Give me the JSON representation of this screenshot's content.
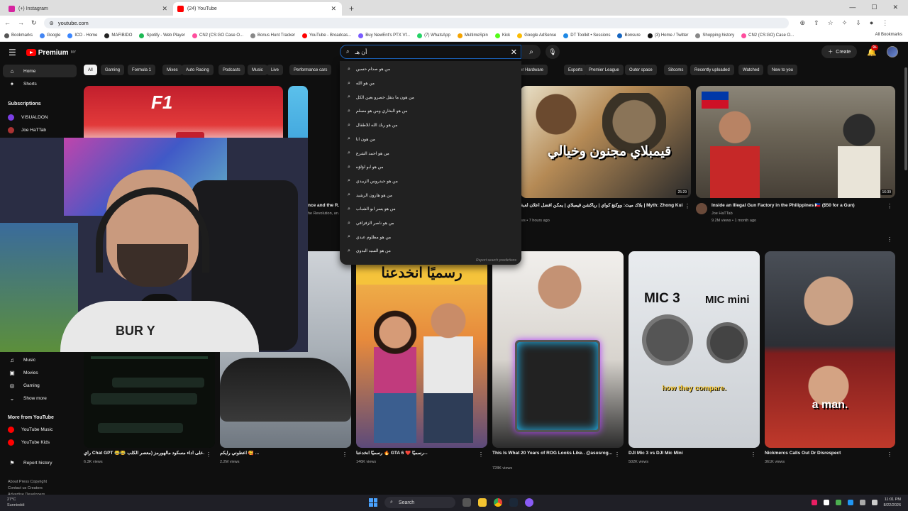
{
  "browser": {
    "tabs": [
      {
        "title": "(+) Instagram",
        "color": "#d6249f",
        "active": false
      },
      {
        "title": "(24) YouTube",
        "color": "#ff0000",
        "active": true
      }
    ],
    "new_tab": "+",
    "url": "youtube.com",
    "bookmarks": [
      {
        "label": "Bookmarks",
        "color": "#555"
      },
      {
        "label": "Google",
        "color": "#4285f4"
      },
      {
        "label": "ICO - Home",
        "color": "#3a86ff"
      },
      {
        "label": "MAFIBIDO",
        "color": "#222"
      },
      {
        "label": "Spotify - Web Player",
        "color": "#1db954"
      },
      {
        "label": "CN2 (CS:GO Case O...",
        "color": "#ff4d9d"
      },
      {
        "label": "Bonus Hunt Tracker",
        "color": "#888"
      },
      {
        "label": "YouTube - Broadcas...",
        "color": "#ff0000"
      },
      {
        "label": "Buy NewEnt's PTX Vf...",
        "color": "#7a5cff"
      },
      {
        "label": "(7) WhatsApp",
        "color": "#25d366"
      },
      {
        "label": "MultimeSpin",
        "color": "#f4a300"
      },
      {
        "label": "Kick",
        "color": "#53fc18"
      },
      {
        "label": "Google AdSense",
        "color": "#fbbc04"
      },
      {
        "label": "DT Toolkit • Sessions",
        "color": "#1e88e5"
      },
      {
        "label": "Bonsure",
        "color": "#1565c0"
      },
      {
        "label": "(3) Home / Twitter",
        "color": "#111"
      },
      {
        "label": "Shopping history",
        "color": "#888"
      },
      {
        "label": "CN2 (CS:GO) Case O...",
        "color": "#ff4d9d"
      }
    ],
    "all_bookmarks": "All Bookmarks"
  },
  "youtube": {
    "logo": "Premium",
    "logo_sup": "MY",
    "search_value": "أن هـ",
    "create": "Create",
    "notif_count": "9+",
    "sidebar": {
      "top": [
        {
          "label": "Home",
          "icon": "⌂",
          "active": true
        },
        {
          "label": "Shorts",
          "icon": "✦",
          "active": false
        }
      ],
      "subs_header": "Subscriptions",
      "subs": [
        {
          "label": "VISUALDON",
          "color": "#7b3fe4"
        },
        {
          "label": "Joe HaTTab",
          "color": "#a33"
        }
      ],
      "explore": [
        {
          "label": "Music",
          "icon": "♫"
        },
        {
          "label": "Movies",
          "icon": "▣"
        },
        {
          "label": "Gaming",
          "icon": "◎"
        },
        {
          "label": "Show more",
          "icon": "⌄"
        }
      ],
      "more_header": "More from YouTube",
      "more": [
        {
          "label": "YouTube Music",
          "color": "#ff0000"
        },
        {
          "label": "YouTube Kids",
          "color": "#ff0000"
        }
      ],
      "report": "Report history",
      "footer": [
        "About  Press  Copyright",
        "Contact us  Creators",
        "Advertise  Developers"
      ]
    },
    "chips": [
      "All",
      "Gaming",
      "Formula 1",
      "Mixes",
      "Auto Racing",
      "Podcasts",
      "Music",
      "Live",
      "Performance cars",
      "uter Hardware",
      "Esports",
      "Premier League",
      "Outer space",
      "Sitcoms",
      "Recently uploaded",
      "Watched",
      "New to you"
    ],
    "suggestions": [
      "من هو صدام حسين",
      "من هو الله",
      "من هون ما بتقل خصرو بعين الكل",
      "من هو البخاري ومن هو مسلم",
      "من هو ربك الله للاطفال",
      "من هون انا",
      "من هو احمد الشرع",
      "من هو ابو لؤلؤه",
      "من هو حيدروس الزبيدي",
      "من هو هارون الرشيد",
      "من هو يسر ابو الشباب",
      "من هو ناصر الزفزافي",
      "من هو مظلوم عبدي",
      "من هو السيد البدوي"
    ],
    "report_predictions": "Report search predictions",
    "videos_row1": [
      {
        "title": "nce and the R...",
        "meta": "he Revolution, an..."
      },
      {
        "title": "بلاك ميث: ووكنغ كواي | رياكشن قيمبلاي | يمكن افضل اعلان لعبة | Myth: Zhong Kui",
        "channel": "",
        "views": "ws • 7 hours ago",
        "duration": "25:29",
        "thumb_text": "قيمبلاي مجنون وخيالي"
      },
      {
        "title": "Inside an Illegal Gun Factory in the Philippines 🇵🇭 ($50 for a Gun)",
        "channel": "Joe HaTTab",
        "views": "9.2M views • 1 month ago",
        "duration": "16:39"
      }
    ],
    "videos_row2": [
      {
        "title": "رأي Chat GPT 😂😂 على أداء مسكود مالهورمز (معصر الكلب...",
        "views": "6.3K views"
      },
      {
        "title": "اعطوني رايكم 🥰 ...",
        "views": "2.2M views"
      },
      {
        "title": "رسميًا انخدعنا 🔥 GTA 6 ❤️ رسميًا...",
        "views": "146K views",
        "thumb_text": "رسميًا انخدعنا"
      },
      {
        "title": "This Is What 20 Years of ROG Looks Like.. @asusrog...",
        "views": "728K views"
      },
      {
        "title": "DJI Mic 3 vs DJI Mic Mini",
        "views": "502K views",
        "thumb_l": "MIC 3",
        "thumb_r": "MIC mini",
        "thumb_caption": "how they compare."
      },
      {
        "title": "Nickmercs Calls Out Dr Disrespect",
        "views": "361K views",
        "thumb_caption": "a man."
      }
    ],
    "cam_text": "BUR    Y",
    "top_thumb_labels": {
      "f1": "F1"
    }
  },
  "taskbar": {
    "weather_temp": "27°C",
    "weather_desc": "Sunnieddi",
    "search": "Search",
    "time": "11:01 PM",
    "date": "8/22/2026"
  }
}
